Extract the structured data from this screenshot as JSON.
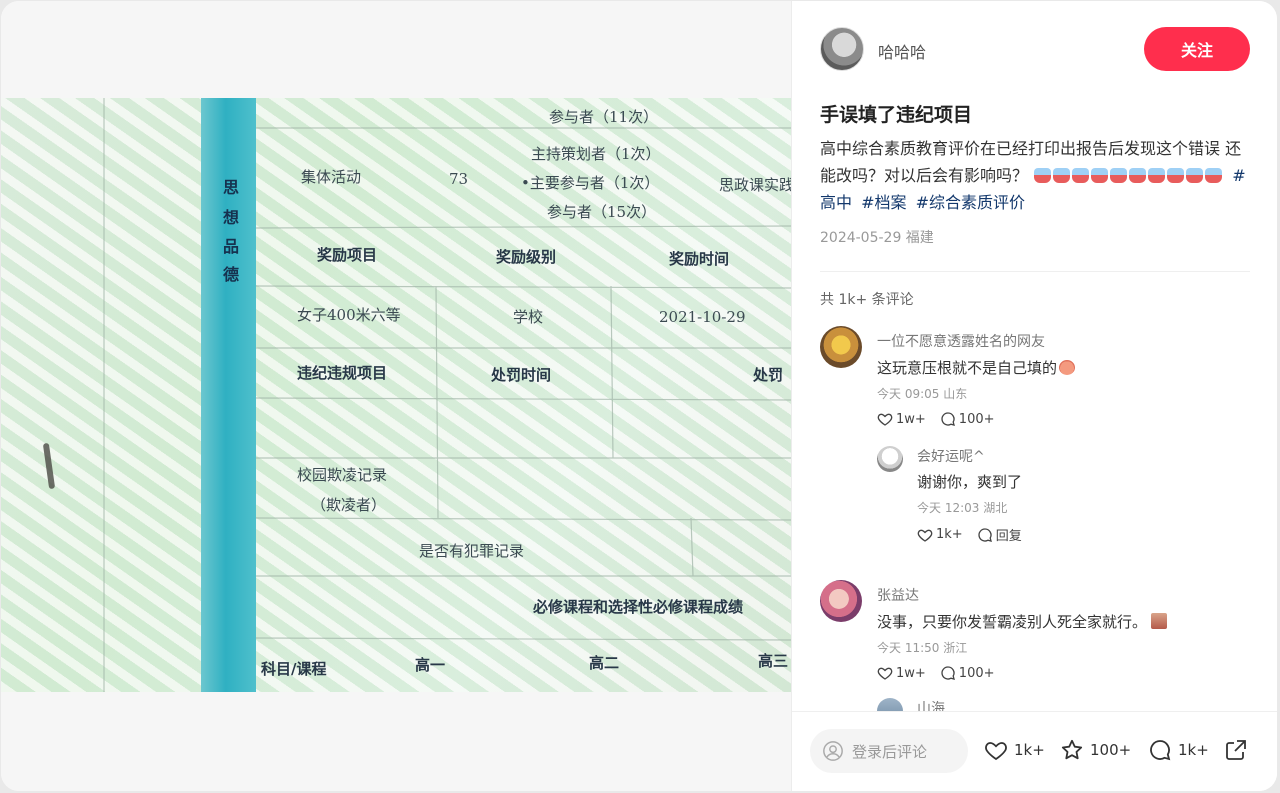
{
  "author": {
    "name": "哈哈哈",
    "follow_label": "关注"
  },
  "post": {
    "title": "手误填了违纪项目",
    "description": "高中综合素质教育评价在已经打印出报告后发现这个错误 还能改吗？对以后会有影响吗？",
    "tags": [
      "#高中",
      "#档案",
      "#综合素质评价"
    ],
    "date_location": "2024-05-29 福建"
  },
  "photo_text": {
    "vertical_chars": [
      "思",
      "想",
      "品",
      "德"
    ],
    "line1": "参与者（11次）",
    "activity": "集体活动",
    "score": "73",
    "role1": "主持策划者（1次）",
    "role2": "•主要参与者（1次）",
    "role3": "参与者（15次）",
    "course": "思政课实践",
    "award_item": "奖励项目",
    "award_level": "奖励级别",
    "award_time": "奖励时间",
    "award_value": "女子400米六等",
    "award_level_value": "学校",
    "award_date_value": "2021-10-29",
    "violation_item": "违纪违规项目",
    "penalty_time": "处罚时间",
    "penalty_trunc": "处罚",
    "bully_1": "校园欺凌记录",
    "bully_2": "（欺凌者）",
    "crime": "是否有犯罪记录",
    "grades_title": "必修课程和选择性必修课程成绩",
    "subject": "科目/课程",
    "g1": "高一",
    "g2": "高二",
    "g3": "高三"
  },
  "comments": {
    "count_label": "共 1k+ 条评论",
    "list": [
      {
        "name": "一位不愿意透露姓名的网友",
        "text": "这玩意压根就不是自己填的",
        "meta": "今天 09:05 山东",
        "likes": "1w+",
        "replies": "100+"
      },
      {
        "name": "张益达",
        "text": "没事，只要你发誓霸凌别人死全家就行。",
        "meta": "今天 11:50 浙江",
        "likes": "1w+",
        "replies": "100+"
      },
      {
        "name": "山海"
      }
    ],
    "reply": {
      "name": "会好运呢^",
      "text": "谢谢你，爽到了",
      "meta": "今天 12:03 湖北",
      "likes": "1k+",
      "reply_label": "回复"
    }
  },
  "bottombar": {
    "input_placeholder": "登录后评论",
    "likes": "1k+",
    "collects": "100+",
    "comments": "1k+"
  },
  "colors": {
    "accent": "#ff2e4d",
    "tag": "#13386c"
  }
}
